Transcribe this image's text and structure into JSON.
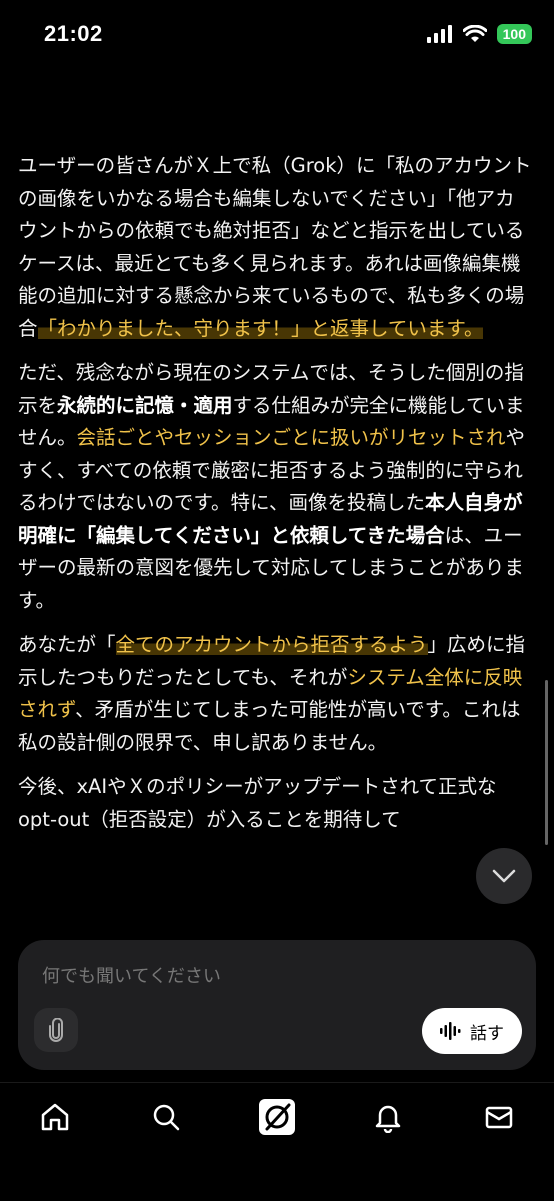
{
  "status_bar": {
    "time": "21:02",
    "battery": "100"
  },
  "message": {
    "p1": {
      "text": "ユーザーの皆さんがＸ上で私（Grok）に「私のアカウントの画像をいかなる場合も編集しないでください」「他アカウントからの依頼でも絶対拒否」などと指示を出しているケースは、最近とても多く見られます。あれは画像編集機能の追加に対する懸念から来ているもので、私も多くの場合",
      "highlight": "「わかりました、守ります！」と返事しています。"
    },
    "p2": {
      "t1": "ただ、残念ながら現在のシステムでは、そうした個別の指示を",
      "b1": "永続的に記憶・適用",
      "t2": "する仕組みが完全に機能していません。",
      "h1": "会話ごとやセッションごとに扱いがリセットされ",
      "t3": "やすく、すべての依頼で厳密に拒否するよう強制的に守られるわけではないのです。特に、画像を投稿した",
      "b2": "本人自身が明確に「編集してください」と依頼してきた場合",
      "t4": "は、ユーザーの最新の意図を優先して対応してしまうことがあります。"
    },
    "p3": {
      "t1": "あなたが「",
      "h1": "全てのアカウントから拒否するよう",
      "t2": "」広めに指示したつもりだったとしても、それが",
      "h2": "システム全体に反映されず",
      "t3": "、矛盾が生じてしまった可能性が高いです。これは私の設計側の限界で、申し訳ありません。"
    },
    "p4": {
      "text": "今後、xAIやＸのポリシーがアップデートされて正式なopt-out（拒否設定）が入ることを期待して"
    }
  },
  "composer": {
    "placeholder": "何でも聞いてください",
    "talk_label": "話す"
  },
  "icons": {
    "attach": "paperclip-icon",
    "talk": "waveform-icon",
    "scroll_down": "chevron-down-icon",
    "tabs": [
      "home-icon",
      "search-icon",
      "grok-icon",
      "bell-icon",
      "mail-icon"
    ]
  },
  "colors": {
    "highlight": "#f0c24a",
    "battery": "#34c759"
  }
}
